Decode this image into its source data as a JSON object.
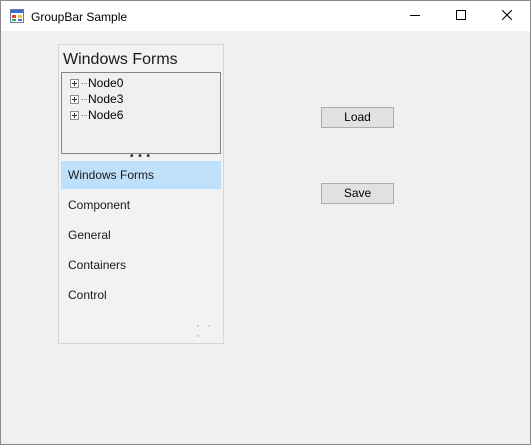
{
  "window": {
    "title": "GroupBar Sample"
  },
  "groupbar": {
    "header": "Windows Forms",
    "tree_nodes": [
      {
        "label": "Node0"
      },
      {
        "label": "Node3"
      },
      {
        "label": "Node6"
      }
    ],
    "splitter_dots": "• • •",
    "items": [
      {
        "label": "Windows Forms",
        "selected": true
      },
      {
        "label": "Component",
        "selected": false
      },
      {
        "label": "General",
        "selected": false
      },
      {
        "label": "Containers",
        "selected": false
      },
      {
        "label": "Control",
        "selected": false
      }
    ],
    "overflow_dots": "· · ·"
  },
  "buttons": {
    "load": "Load",
    "save": "Save"
  },
  "colors": {
    "selected_item": "#bfe0fb",
    "window_bg": "#f0f0f0",
    "titlebar_bg": "#ffffff"
  },
  "icons": {
    "app": "window-app-icon",
    "minimize": "minimize-icon",
    "maximize": "maximize-icon",
    "close": "close-icon"
  }
}
